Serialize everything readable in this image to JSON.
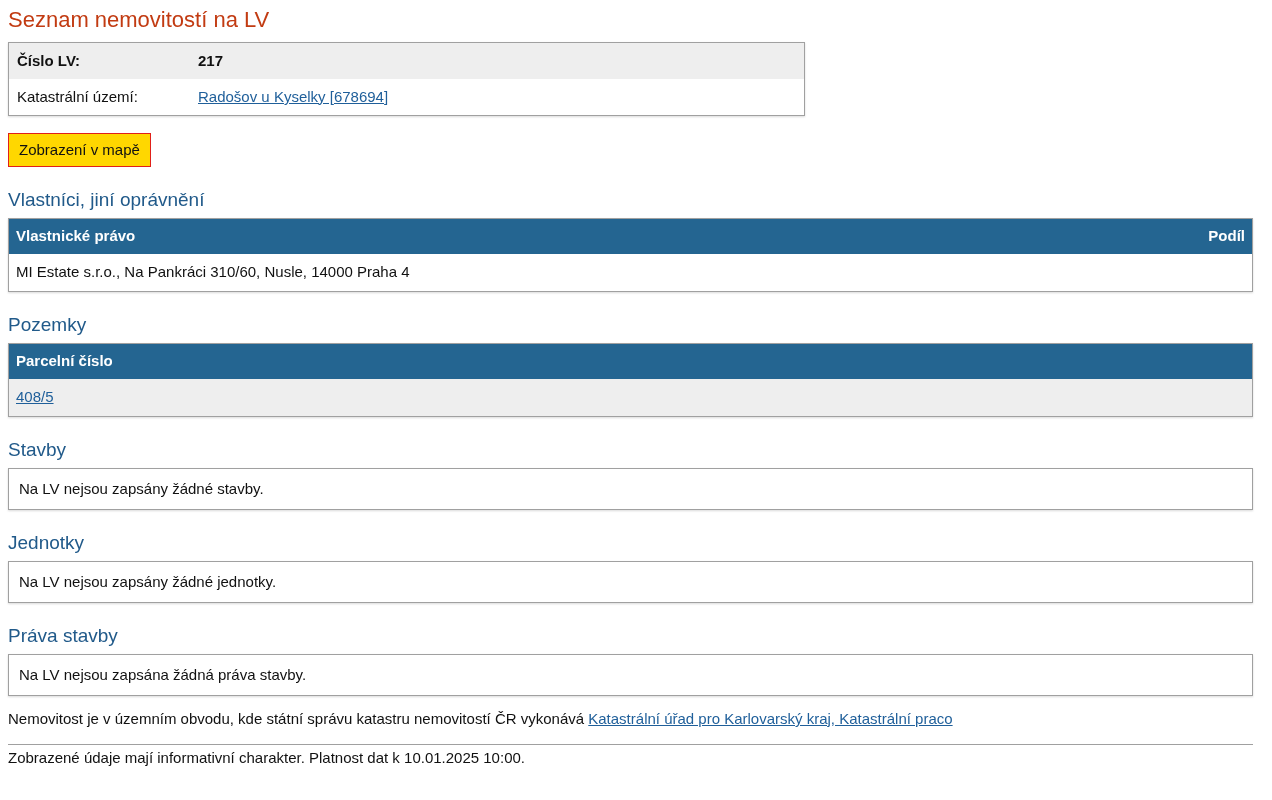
{
  "title": "Seznam nemovitostí na LV",
  "info_table": {
    "rows": [
      {
        "label": "Číslo LV:",
        "value": "217",
        "kind": "heading"
      },
      {
        "label": "Katastrální území:",
        "value": "Radošov u Kyselky [678694]",
        "kind": "link"
      }
    ]
  },
  "map_button": "Zobrazení v mapě",
  "sections": [
    {
      "heading": "Vlastníci, jiní oprávnění",
      "kind": "table",
      "columns": [
        "Vlastnické právo",
        "Podíl"
      ],
      "rows": [
        {
          "shaded": false,
          "cells": [
            {
              "text": "MI Estate s.r.o., Na Pankráci 310/60, Nusle, 14000 Praha 4",
              "kind": "text"
            }
          ]
        }
      ]
    },
    {
      "heading": "Pozemky",
      "kind": "table",
      "columns": [
        "Parcelní číslo"
      ],
      "rows": [
        {
          "shaded": true,
          "cells": [
            {
              "text": "408/5",
              "kind": "link"
            }
          ]
        }
      ]
    },
    {
      "heading": "Stavby",
      "kind": "message",
      "message": "Na LV nejsou zapsány žádné stavby."
    },
    {
      "heading": "Jednotky",
      "kind": "message",
      "message": "Na LV nejsou zapsány žádné jednotky."
    },
    {
      "heading": "Práva stavby",
      "kind": "message",
      "message": "Na LV nejsou zapsána žádná práva stavby."
    }
  ],
  "note": {
    "text": "Nemovitost je v územním obvodu, kde státní správu katastru nemovitostí ČR vykonává",
    "link": "Katastrální úřad pro Karlovarský kraj, Katastrální praco"
  },
  "footer": "Zobrazené údaje mají informativní charakter. Platnost dat k 10.01.2025 10:00."
}
